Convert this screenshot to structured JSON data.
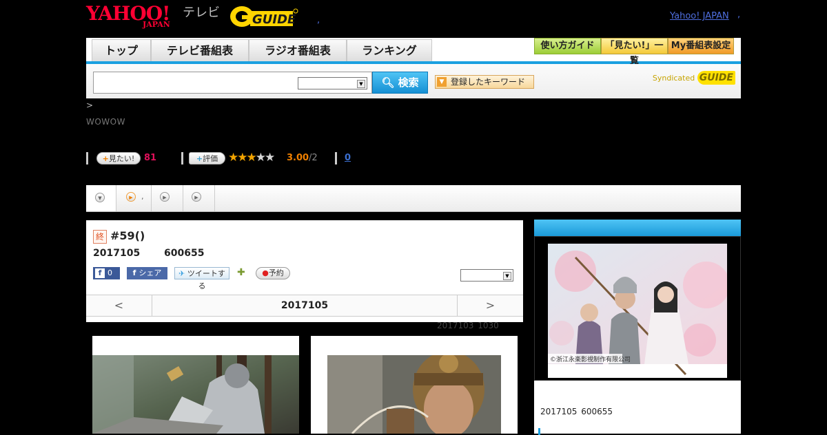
{
  "header": {
    "logo_yahoo_top": "YAHOO!",
    "logo_yahoo_bottom": "JAPAN",
    "logo_tv": "テレビ",
    "logo_gguide": "G-GUIDE",
    "japan_link": "Yahoo! JAPAN",
    "dot": ","
  },
  "nav": {
    "tabs": [
      "トップ",
      "テレビ番組表",
      "ラジオ番組表",
      "ランキング"
    ],
    "buttons": [
      "使い方ガイド",
      "「見たい!」一覧",
      "My番組表設定"
    ]
  },
  "search": {
    "placeholder": "",
    "button_label": "検索",
    "keyword_label": "登録したキーワード",
    "syndicated_label": "Syndicated",
    "syndicated_g": "GUIDE"
  },
  "breadcrumb": ">",
  "channel": "WOWOW",
  "stats": {
    "want_label": "見たい!",
    "want_count": "81",
    "rate_label": "評価",
    "rating": 3.0,
    "score": "3.00",
    "score_total": "/2",
    "comments": "0"
  },
  "tabs": {
    "tab2_dot": ","
  },
  "episode": {
    "badge": "終",
    "title": "#59()",
    "date": "2017105",
    "code": "600655",
    "fb_count": "0",
    "share_label": "シェア",
    "tweet_label": "ツイートする",
    "reserve_label": "予約",
    "prev": "<",
    "current": "2017105",
    "next": ">",
    "updated": "2017103 1030"
  },
  "sidebar": {
    "poster_credit": "©浙江永楽影視制作有限公司",
    "info": "2017105 600655"
  },
  "colors": {
    "accent_blue": "#1aa0e0",
    "yahoo_red": "#ff0033",
    "star": "#f2a400"
  }
}
